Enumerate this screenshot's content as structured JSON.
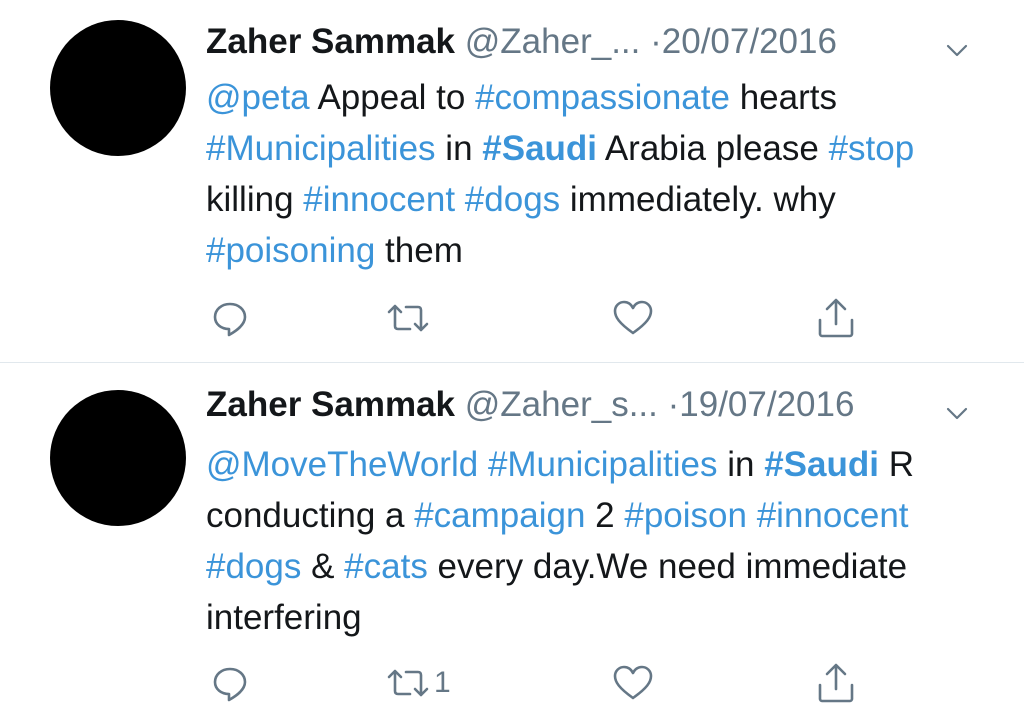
{
  "tweets": [
    {
      "author_name": "Zaher Sammak",
      "handle": "@Zaher_...",
      "separator": "·",
      "date": "20/07/2016",
      "text_parts": [
        {
          "type": "mention",
          "text": "@peta"
        },
        {
          "type": "text",
          "text": " Appeal to "
        },
        {
          "type": "hashtag",
          "text": "#compassionate"
        },
        {
          "type": "text",
          "text": " hearts "
        },
        {
          "type": "hashtag",
          "text": "#Municipalities"
        },
        {
          "type": "text",
          "text": " in "
        },
        {
          "type": "hashtag-bold",
          "text": "#Saudi"
        },
        {
          "type": "text",
          "text": " Arabia please "
        },
        {
          "type": "hashtag",
          "text": "#stop"
        },
        {
          "type": "text",
          "text": " killing "
        },
        {
          "type": "hashtag",
          "text": "#innocent"
        },
        {
          "type": "text",
          "text": " "
        },
        {
          "type": "hashtag",
          "text": "#dogs"
        },
        {
          "type": "text",
          "text": " immediately. why "
        },
        {
          "type": "hashtag",
          "text": "#poisoning"
        },
        {
          "type": "text",
          "text": " them"
        }
      ],
      "actions": {
        "reply_icon": "reply-icon",
        "retweet_icon": "retweet-icon",
        "retweet_count": "",
        "like_icon": "heart-icon",
        "share_icon": "share-icon"
      }
    },
    {
      "author_name": "Zaher Sammak",
      "handle": "@Zaher_s...",
      "separator": "·",
      "date": "19/07/2016",
      "text_parts": [
        {
          "type": "mention",
          "text": "@MoveTheWorld"
        },
        {
          "type": "text",
          "text": " "
        },
        {
          "type": "hashtag",
          "text": "#Municipalities"
        },
        {
          "type": "text",
          "text": " in "
        },
        {
          "type": "hashtag-bold",
          "text": "#Saudi"
        },
        {
          "type": "text",
          "text": " R conducting a "
        },
        {
          "type": "hashtag",
          "text": "#campaign"
        },
        {
          "type": "text",
          "text": " 2 "
        },
        {
          "type": "hashtag",
          "text": "#poison"
        },
        {
          "type": "text",
          "text": " "
        },
        {
          "type": "hashtag",
          "text": "#innocent"
        },
        {
          "type": "text",
          "text": " "
        },
        {
          "type": "hashtag",
          "text": "#dogs"
        },
        {
          "type": "text",
          "text": " & "
        },
        {
          "type": "hashtag",
          "text": "#cats"
        },
        {
          "type": "text",
          "text": " every day.We need immediate interfering"
        }
      ],
      "actions": {
        "reply_icon": "reply-icon",
        "retweet_icon": "retweet-icon",
        "retweet_count": "1",
        "like_icon": "heart-icon",
        "share_icon": "share-icon"
      }
    }
  ],
  "colors": {
    "link": "#3b94d9",
    "secondary_text": "#657786",
    "primary_text": "#14171a",
    "icon": "#657786",
    "divider": "#e1e8ed",
    "avatar": "#000000"
  }
}
